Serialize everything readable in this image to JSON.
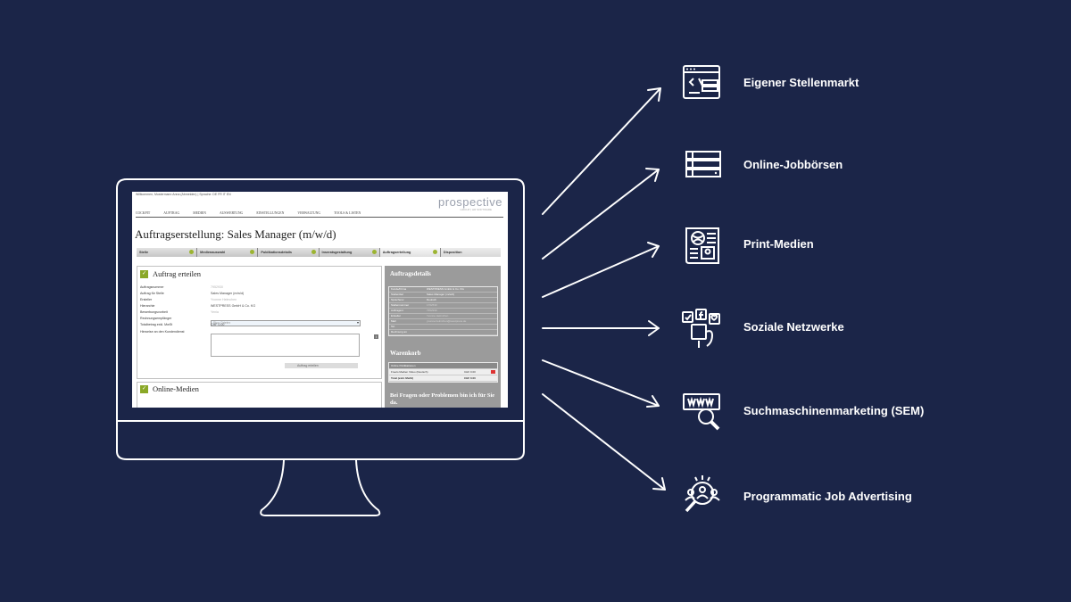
{
  "screen": {
    "topbar": "Willkommen, Mustermann Anna (Abmelden) | Sprache: DE FR IT EN",
    "logo": "prospective",
    "logo_sub": "GROUP | HR SOFTWARE",
    "nav": [
      "COCKPIT",
      "AUFTRAG",
      "MEDIEN",
      "AUSWERTUNG",
      "EINSTELLUNGEN",
      "VERWALTUNG",
      "TOOLS & LISTEN"
    ],
    "title": "Auftragserstellung: Sales Manager (m/w/d)",
    "steps": [
      "Stelle",
      "Medienauswahl",
      "Publikationsdetails",
      "Inseratsgestaltung",
      "Auftragserteilung",
      "Disposition"
    ],
    "active_step": "Auftragserteilung",
    "panel_title": "Auftrag erteilen",
    "fields": [
      {
        "label": "Auftragsnummer",
        "value": "7952930"
      },
      {
        "label": "Auftrag für Stelle",
        "value": "Sales Manager (m/w/d)"
      },
      {
        "label": "Ersteller",
        "value": "Yvonne Helmchen"
      },
      {
        "label": "Hierarchie",
        "value": "WESTPRESS GmbH & Co. KG"
      },
      {
        "label": "Bewerbungsvorbeit",
        "value": "Yenia"
      },
      {
        "label": "Rechnungsempfänger",
        "value": "Rico Ortelex"
      },
      {
        "label": "Totalbetrag exkl. MwSt",
        "value": "CHF 0.00"
      },
      {
        "label": "Hinweise an den Kundendienst",
        "value": ""
      }
    ],
    "submit_label": "Auftrag erteilen",
    "panel2_title": "Online-Medien",
    "side_title": "Auftragsdetails",
    "side_rows": [
      {
        "label": "Kunde/Firma",
        "value": "WESTPRESS GmbH & Co. KG"
      },
      {
        "label": "Stellentitel",
        "value": "Sales Manager (m/w/d)"
      },
      {
        "label": "Sprachenv.",
        "value": "Deutsch"
      },
      {
        "label": "Stellennummer",
        "value": "1762530"
      },
      {
        "label": "Auftragsnr.",
        "value": "7952930"
      },
      {
        "label": "Ersteller",
        "value": "Yvonne Helmchen"
      },
      {
        "label": "Mail",
        "value": "yvonne.helmchen@westpress.de"
      },
      {
        "label": "Tel.",
        "value": ""
      },
      {
        "label": "Rechnung an",
        "value": ""
      }
    ],
    "cart_title": "Warenkorb",
    "cart_rows": [
      {
        "label": "Online Publikationen",
        "value": ""
      },
      {
        "label": "Freelo Medien Video (Deutsch)",
        "value": "CHF 0.00"
      },
      {
        "label": "Total (exkl. MwSt)",
        "value": "CHF 0.00"
      }
    ],
    "help_text": "Bei Fragen oder Problemen bin ich für Sie da."
  },
  "channels": [
    {
      "label": "Eigener Stellenmarkt",
      "icon": "career-site-icon"
    },
    {
      "label": "Online-Jobbörsen",
      "icon": "job-board-list-icon"
    },
    {
      "label": "Print-Medien",
      "icon": "newspaper-icon"
    },
    {
      "label": "Soziale Netzwerke",
      "icon": "social-network-icon"
    },
    {
      "label": "Suchmaschinenmarketing (SEM)",
      "icon": "www-search-icon"
    },
    {
      "label": "Programmatic Job Advertising",
      "icon": "audience-target-icon"
    }
  ],
  "colors": {
    "background": "#1b2548",
    "accent_green": "#8aa827",
    "sidebar_gray": "#9b9b9b"
  }
}
